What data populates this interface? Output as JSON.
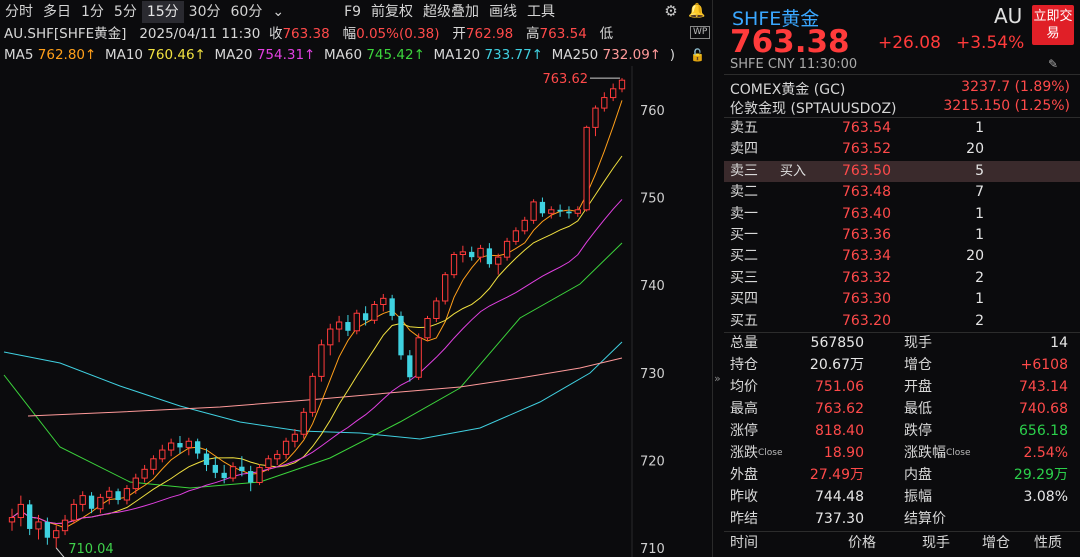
{
  "toolbar": {
    "timeframes": [
      "分时",
      "多日",
      "1分",
      "5分",
      "15分",
      "30分",
      "60分"
    ],
    "active_timeframe": "15分",
    "dropdown": "⌄",
    "tools": [
      "F9",
      "前复权",
      "超级叠加",
      "画线",
      "工具"
    ]
  },
  "info": {
    "symbol": "AU.SHF[SHFE黄金]",
    "datetime": "2025/04/11 11:30",
    "close_label": "收",
    "close": "763.38",
    "range_label": "幅",
    "range": "0.05%(0.38)",
    "open_label": "开",
    "open": "762.98",
    "high_label": "高",
    "high": "763.54",
    "low_label": "低"
  },
  "ma": [
    {
      "label": "MA5",
      "value": "762.80↑",
      "color": "#ff9f1a"
    },
    {
      "label": "MA10",
      "value": "760.46↑",
      "color": "#f0e040"
    },
    {
      "label": "MA20",
      "value": "754.31↑",
      "color": "#e040e0"
    },
    {
      "label": "MA60",
      "value": "745.42↑",
      "color": "#3cd43c"
    },
    {
      "label": "MA120",
      "value": "733.77↑",
      "color": "#40d0e0"
    },
    {
      "label": "MA250",
      "value": "732.09↑",
      "color": "#ff9a9a"
    }
  ],
  "ma_tail": ")",
  "chart_data": {
    "type": "candlestick",
    "y_ticks": [
      760,
      750,
      740,
      730,
      720,
      710
    ],
    "ylim": [
      709,
      765
    ],
    "high_annotation": "763.62",
    "low_annotation": "710.04",
    "candles": [
      [
        713.0,
        714.5,
        712.0,
        713.5
      ],
      [
        713.5,
        716.0,
        712.5,
        715.0
      ],
      [
        715.0,
        715.5,
        711.5,
        712.2
      ],
      [
        712.2,
        713.8,
        711.0,
        713.0
      ],
      [
        713.0,
        713.5,
        710.4,
        711.2
      ],
      [
        711.2,
        712.6,
        710.04,
        712.0
      ],
      [
        712.0,
        713.8,
        711.5,
        713.2
      ],
      [
        713.2,
        715.6,
        712.8,
        715.0
      ],
      [
        715.0,
        716.5,
        714.2,
        716.0
      ],
      [
        716.0,
        716.4,
        714.0,
        714.5
      ],
      [
        714.5,
        716.2,
        714.0,
        715.8
      ],
      [
        715.8,
        717.0,
        715.0,
        716.5
      ],
      [
        716.5,
        716.8,
        715.0,
        715.5
      ],
      [
        715.5,
        717.2,
        715.0,
        716.8
      ],
      [
        716.8,
        718.5,
        716.2,
        718.0
      ],
      [
        718.0,
        719.5,
        717.5,
        719.0
      ],
      [
        719.0,
        720.6,
        718.4,
        720.2
      ],
      [
        720.2,
        721.8,
        719.8,
        721.2
      ],
      [
        721.2,
        722.5,
        720.5,
        722.0
      ],
      [
        722.0,
        722.8,
        720.8,
        721.5
      ],
      [
        721.5,
        722.6,
        720.6,
        722.2
      ],
      [
        722.2,
        722.5,
        720.2,
        720.8
      ],
      [
        720.8,
        721.4,
        718.8,
        719.5
      ],
      [
        719.5,
        720.4,
        718.0,
        718.6
      ],
      [
        718.6,
        719.5,
        717.4,
        718.0
      ],
      [
        718.0,
        719.8,
        717.6,
        719.3
      ],
      [
        719.3,
        720.5,
        718.2,
        718.8
      ],
      [
        718.8,
        719.4,
        716.5,
        717.5
      ],
      [
        717.5,
        719.6,
        717.2,
        719.2
      ],
      [
        719.2,
        720.6,
        718.8,
        720.2
      ],
      [
        720.2,
        721.2,
        719.5,
        720.7
      ],
      [
        720.7,
        722.6,
        720.2,
        722.2
      ],
      [
        722.2,
        723.6,
        721.5,
        723.0
      ],
      [
        723.0,
        726.0,
        722.5,
        725.5
      ],
      [
        725.5,
        730.0,
        725.0,
        729.6
      ],
      [
        729.6,
        733.8,
        729.0,
        733.2
      ],
      [
        733.2,
        735.6,
        732.0,
        735.0
      ],
      [
        735.0,
        736.5,
        733.5,
        735.8
      ],
      [
        735.8,
        736.6,
        734.2,
        734.8
      ],
      [
        734.8,
        737.2,
        734.4,
        736.8
      ],
      [
        736.8,
        737.6,
        735.4,
        736.0
      ],
      [
        736.0,
        738.2,
        735.6,
        737.8
      ],
      [
        737.8,
        739.0,
        737.0,
        738.5
      ],
      [
        738.5,
        738.9,
        736.0,
        736.5
      ],
      [
        736.5,
        737.0,
        731.5,
        732.0
      ],
      [
        732.0,
        732.6,
        729.0,
        729.5
      ],
      [
        729.5,
        734.5,
        729.2,
        734.0
      ],
      [
        734.0,
        736.5,
        733.6,
        736.2
      ],
      [
        736.2,
        738.6,
        735.8,
        738.2
      ],
      [
        738.2,
        741.5,
        737.8,
        741.2
      ],
      [
        741.2,
        743.8,
        740.8,
        743.5
      ],
      [
        743.5,
        744.5,
        742.6,
        743.8
      ],
      [
        743.8,
        744.4,
        742.8,
        743.2
      ],
      [
        743.2,
        744.6,
        742.6,
        744.2
      ],
      [
        744.2,
        744.8,
        742.0,
        742.4
      ],
      [
        742.4,
        743.6,
        741.2,
        743.2
      ],
      [
        743.2,
        745.4,
        742.8,
        745.0
      ],
      [
        745.0,
        746.6,
        744.6,
        746.2
      ],
      [
        746.2,
        747.8,
        745.8,
        747.4
      ],
      [
        747.4,
        749.8,
        747.0,
        749.5
      ],
      [
        749.5,
        750.0,
        747.8,
        748.2
      ],
      [
        748.2,
        749.0,
        747.6,
        748.6
      ],
      [
        748.6,
        749.2,
        747.8,
        748.4
      ],
      [
        748.4,
        749.0,
        747.6,
        748.2
      ],
      [
        748.2,
        749.0,
        747.8,
        748.6
      ],
      [
        748.6,
        758.2,
        748.4,
        758.0
      ],
      [
        758.0,
        760.5,
        757.0,
        760.2
      ],
      [
        760.2,
        762.0,
        759.8,
        761.4
      ],
      [
        761.4,
        763.0,
        761.0,
        762.4
      ],
      [
        762.4,
        763.62,
        762.0,
        763.38
      ]
    ]
  },
  "quote": {
    "name": "SHFE黄金",
    "code": "AU",
    "trade_button": "立即交易",
    "price": "763.38",
    "change": "+26.08",
    "change_pct": "+3.54%",
    "meta": "SHFE  CNY  11:30:00",
    "related": [
      {
        "name": "COMEX黄金 (GC)",
        "value": "3237.7  (1.89%)"
      },
      {
        "name": "伦敦金现  (SPTAUUSDOZ)",
        "value": "3215.150  (1.25%)"
      }
    ],
    "orderbook": [
      {
        "label": "卖五",
        "tag": "",
        "price": "763.54",
        "vol": "1"
      },
      {
        "label": "卖四",
        "tag": "",
        "price": "763.52",
        "vol": "20"
      },
      {
        "label": "卖三",
        "tag": "买入",
        "price": "763.50",
        "vol": "5",
        "highlight": true
      },
      {
        "label": "卖二",
        "tag": "",
        "price": "763.48",
        "vol": "7"
      },
      {
        "label": "卖一",
        "tag": "",
        "price": "763.40",
        "vol": "1"
      },
      {
        "label": "买一",
        "tag": "",
        "price": "763.36",
        "vol": "1"
      },
      {
        "label": "买二",
        "tag": "",
        "price": "763.34",
        "vol": "20"
      },
      {
        "label": "买三",
        "tag": "",
        "price": "763.32",
        "vol": "2"
      },
      {
        "label": "买四",
        "tag": "",
        "price": "763.30",
        "vol": "1"
      },
      {
        "label": "买五",
        "tag": "",
        "price": "763.20",
        "vol": "2"
      }
    ],
    "stats": [
      {
        "l": "总量",
        "lv": "567850",
        "lc": "c-wht",
        "r": "现手",
        "rv": "14",
        "rc": "c-wht"
      },
      {
        "l": "持仓",
        "lv": "20.67万",
        "lc": "c-wht",
        "r": "增仓",
        "rv": "+6108",
        "rc": "c-red"
      },
      {
        "l": "均价",
        "lv": "751.06",
        "lc": "c-red",
        "r": "开盘",
        "rv": "743.14",
        "rc": "c-red"
      },
      {
        "l": "最高",
        "lv": "763.62",
        "lc": "c-red",
        "r": "最低",
        "rv": "740.68",
        "rc": "c-red"
      },
      {
        "l": "涨停",
        "lv": "818.40",
        "lc": "c-red",
        "r": "跌停",
        "rv": "656.18",
        "rc": "c-grn"
      },
      {
        "l": "涨跌",
        "lsup": "Close",
        "lv": "18.90",
        "lc": "c-red",
        "r": "涨跌幅",
        "rsup": "Close",
        "rv": "2.54%",
        "rc": "c-red"
      },
      {
        "l": "外盘",
        "lv": "27.49万",
        "lc": "c-red",
        "r": "内盘",
        "rv": "29.29万",
        "rc": "c-grn"
      },
      {
        "l": "昨收",
        "lv": "744.48",
        "lc": "c-wht",
        "r": "振幅",
        "rv": "3.08%",
        "rc": "c-wht"
      },
      {
        "l": "昨结",
        "lv": "737.30",
        "lc": "c-wht",
        "r": "结算价",
        "rv": "",
        "rc": "c-wht"
      }
    ],
    "tick_headers": [
      "时间",
      "价格",
      "现手",
      "增仓",
      "性质"
    ]
  }
}
